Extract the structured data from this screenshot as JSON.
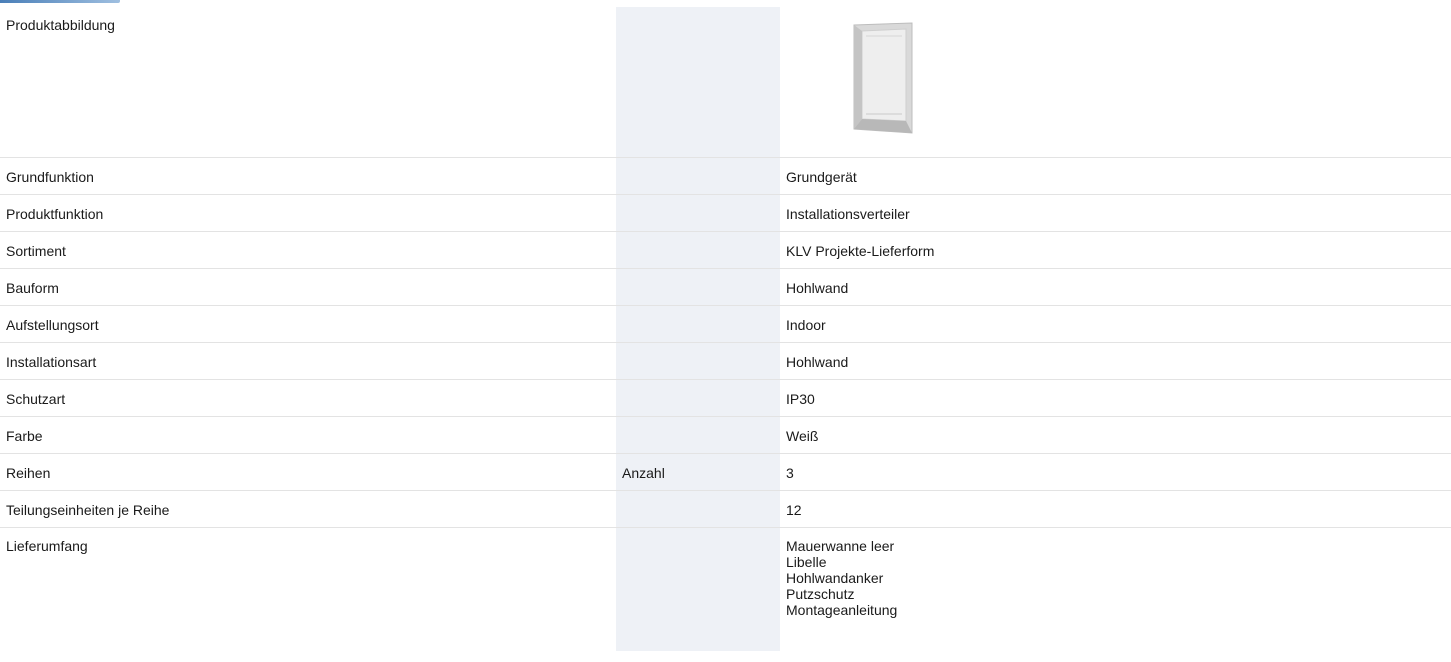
{
  "rows": [
    {
      "label": "Produktabbildung",
      "unit": "",
      "value": ""
    },
    {
      "label": "Grundfunktion",
      "unit": "",
      "value": "Grundgerät"
    },
    {
      "label": "Produktfunktion",
      "unit": "",
      "value": "Installationsverteiler"
    },
    {
      "label": "Sortiment",
      "unit": "",
      "value": "KLV Projekte-Lieferform"
    },
    {
      "label": "Bauform",
      "unit": "",
      "value": "Hohlwand"
    },
    {
      "label": "Aufstellungsort",
      "unit": "",
      "value": "Indoor"
    },
    {
      "label": "Installationsart",
      "unit": "",
      "value": "Hohlwand"
    },
    {
      "label": "Schutzart",
      "unit": "",
      "value": "IP30"
    },
    {
      "label": "Farbe",
      "unit": "",
      "value": "Weiß"
    },
    {
      "label": "Reihen",
      "unit": "Anzahl",
      "value": "3"
    },
    {
      "label": "Teilungseinheiten je Reihe",
      "unit": "",
      "value": "12"
    },
    {
      "label": "Lieferumfang",
      "unit": "",
      "values": [
        "Mauerwanne leer",
        "Libelle",
        "Hohlwandanker",
        "Putzschutz",
        "Montageanleitung"
      ]
    }
  ],
  "colors": {
    "shaded_column": "#eef1f6",
    "row_divider": "#e3e3e3",
    "accent": "#4a7fb8"
  },
  "icons": {
    "product_image": "distribution-box-frame-image"
  }
}
